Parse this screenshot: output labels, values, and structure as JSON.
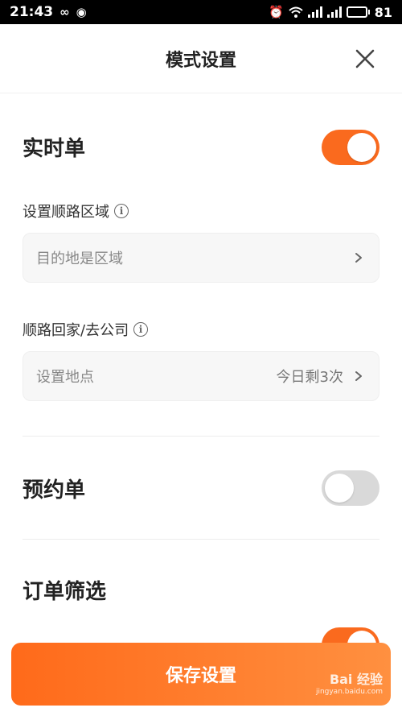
{
  "status_bar": {
    "time": "21:43",
    "battery": "81",
    "battery_percent": 81
  },
  "header": {
    "title": "模式设置"
  },
  "realtime": {
    "title": "实时单",
    "enabled": true
  },
  "route_area": {
    "label": "设置顺路区域",
    "placeholder": "目的地是区域"
  },
  "route_home": {
    "label": "顺路回家/去公司",
    "placeholder": "设置地点",
    "remaining": "今日剩3次"
  },
  "reservation": {
    "title": "预约单",
    "enabled": false
  },
  "filter": {
    "title": "订单筛选"
  },
  "save": {
    "label": "保存设置"
  },
  "watermark": {
    "brand": "Bai 经验",
    "url": "jingyan.baidu.com"
  },
  "colors": {
    "accent": "#fa6a1e",
    "toggle_off": "#d9d9d9"
  }
}
